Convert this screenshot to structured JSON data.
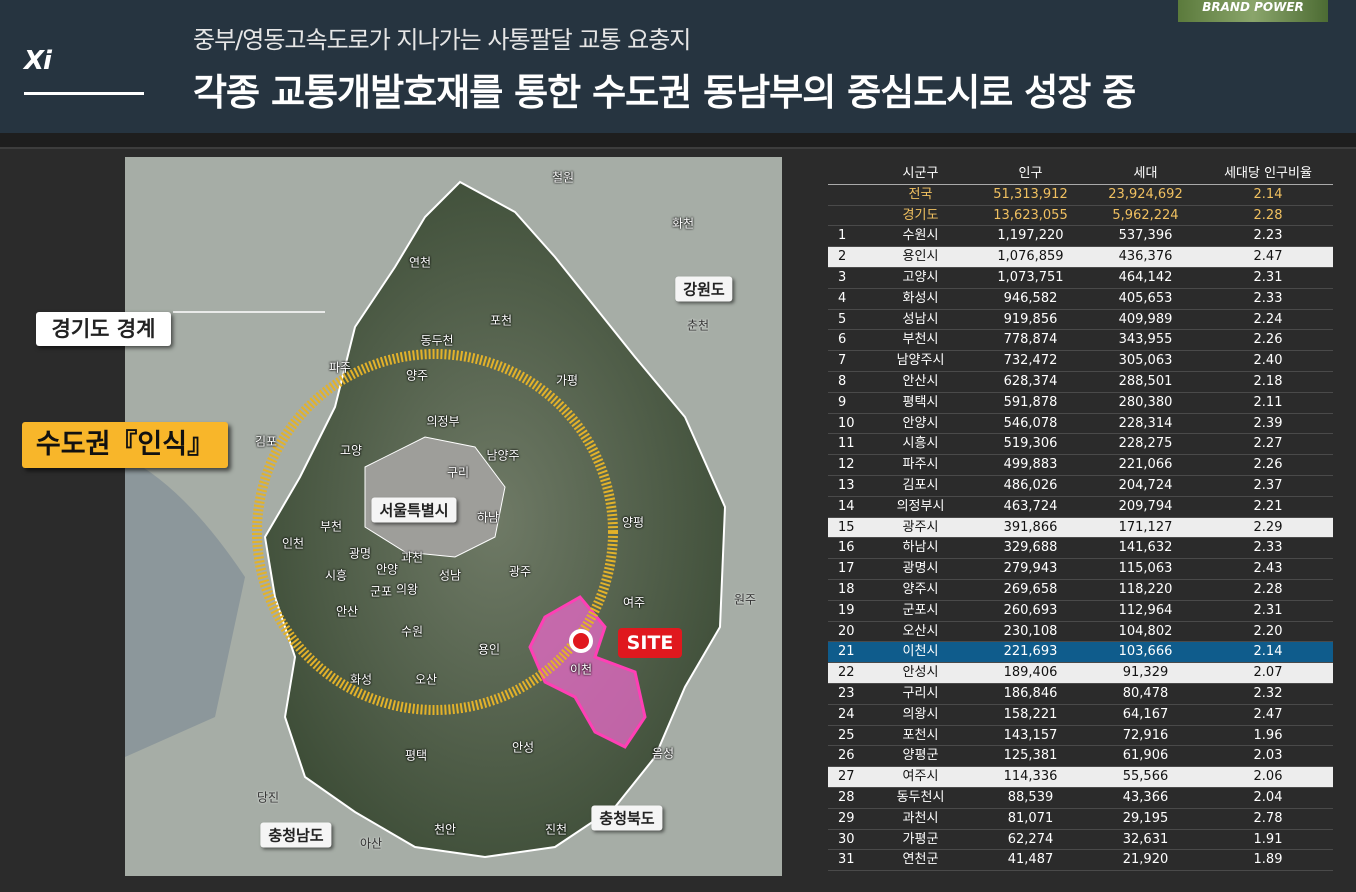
{
  "header": {
    "logo": "Xi",
    "subtitle": "중부/영동고속도로가 지나가는 사통팔달 교통 요충지",
    "title": "각종 교통개발호재를 통한 수도권 동남부의 중심도시로 성장 중",
    "brand_badge": "BRAND POWER"
  },
  "map": {
    "callout_border": "경기도 경계",
    "callout_metro": "수도권『인식』",
    "site_label": "SITE",
    "boxed": {
      "seoul": "서울특별시",
      "gangwon": "강원도",
      "chungbuk": "충청북도",
      "chungnam": "충청남도"
    },
    "places": {
      "cheorwon": "철원",
      "hwacheon": "화천",
      "yeoncheon": "연천",
      "dongducheon": "동두천",
      "pocheon": "포천",
      "chuncheon": "춘천",
      "paju": "파주",
      "yangju": "양주",
      "gapyeong": "가평",
      "uijeongbu": "의정부",
      "gimpo": "김포",
      "goyang": "고양",
      "guri": "구리",
      "namyangju": "남양주",
      "hanam": "하남",
      "yangpyeong": "양평",
      "incheon": "인천",
      "bucheon": "부천",
      "gwangmyeong": "광명",
      "gwacheon": "과천",
      "anyang": "안양",
      "siheung": "시흥",
      "gunpo": "군포",
      "uiwang": "의왕",
      "seongnam": "성남",
      "gwangju": "광주",
      "ansan": "안산",
      "suwon": "수원",
      "yeoju": "여주",
      "wonju": "원주",
      "yongin": "용인",
      "icheon": "이천",
      "hwaseong": "화성",
      "osan": "오산",
      "anseong": "안성",
      "eumseong": "음성",
      "pyeongtaek": "평택",
      "dangjin": "당진",
      "asan": "아산",
      "cheonan": "천안",
      "jincheon": "진천"
    }
  },
  "table": {
    "headers": [
      "시군구",
      "인구",
      "세대",
      "세대당 인구비율"
    ],
    "summary": [
      {
        "name": "전국",
        "pop": "51,313,912",
        "hh": "23,924,692",
        "ratio": "2.14"
      },
      {
        "name": "경기도",
        "pop": "13,623,055",
        "hh": "5,962,224",
        "ratio": "2.28"
      }
    ],
    "rows": [
      {
        "rank": "1",
        "name": "수원시",
        "pop": "1,197,220",
        "hh": "537,396",
        "ratio": "2.23"
      },
      {
        "rank": "2",
        "name": "용인시",
        "pop": "1,076,859",
        "hh": "436,376",
        "ratio": "2.47"
      },
      {
        "rank": "3",
        "name": "고양시",
        "pop": "1,073,751",
        "hh": "464,142",
        "ratio": "2.31"
      },
      {
        "rank": "4",
        "name": "화성시",
        "pop": "946,582",
        "hh": "405,653",
        "ratio": "2.33"
      },
      {
        "rank": "5",
        "name": "성남시",
        "pop": "919,856",
        "hh": "409,989",
        "ratio": "2.24"
      },
      {
        "rank": "6",
        "name": "부천시",
        "pop": "778,874",
        "hh": "343,955",
        "ratio": "2.26"
      },
      {
        "rank": "7",
        "name": "남양주시",
        "pop": "732,472",
        "hh": "305,063",
        "ratio": "2.40"
      },
      {
        "rank": "8",
        "name": "안산시",
        "pop": "628,374",
        "hh": "288,501",
        "ratio": "2.18"
      },
      {
        "rank": "9",
        "name": "평택시",
        "pop": "591,878",
        "hh": "280,380",
        "ratio": "2.11"
      },
      {
        "rank": "10",
        "name": "안양시",
        "pop": "546,078",
        "hh": "228,314",
        "ratio": "2.39"
      },
      {
        "rank": "11",
        "name": "시흥시",
        "pop": "519,306",
        "hh": "228,275",
        "ratio": "2.27"
      },
      {
        "rank": "12",
        "name": "파주시",
        "pop": "499,883",
        "hh": "221,066",
        "ratio": "2.26"
      },
      {
        "rank": "13",
        "name": "김포시",
        "pop": "486,026",
        "hh": "204,724",
        "ratio": "2.37"
      },
      {
        "rank": "14",
        "name": "의정부시",
        "pop": "463,724",
        "hh": "209,794",
        "ratio": "2.21"
      },
      {
        "rank": "15",
        "name": "광주시",
        "pop": "391,866",
        "hh": "171,127",
        "ratio": "2.29"
      },
      {
        "rank": "16",
        "name": "하남시",
        "pop": "329,688",
        "hh": "141,632",
        "ratio": "2.33"
      },
      {
        "rank": "17",
        "name": "광명시",
        "pop": "279,943",
        "hh": "115,063",
        "ratio": "2.43"
      },
      {
        "rank": "18",
        "name": "양주시",
        "pop": "269,658",
        "hh": "118,220",
        "ratio": "2.28"
      },
      {
        "rank": "19",
        "name": "군포시",
        "pop": "260,693",
        "hh": "112,964",
        "ratio": "2.31"
      },
      {
        "rank": "20",
        "name": "오산시",
        "pop": "230,108",
        "hh": "104,802",
        "ratio": "2.20"
      },
      {
        "rank": "21",
        "name": "이천시",
        "pop": "221,693",
        "hh": "103,666",
        "ratio": "2.14"
      },
      {
        "rank": "22",
        "name": "안성시",
        "pop": "189,406",
        "hh": "91,329",
        "ratio": "2.07"
      },
      {
        "rank": "23",
        "name": "구리시",
        "pop": "186,846",
        "hh": "80,478",
        "ratio": "2.32"
      },
      {
        "rank": "24",
        "name": "의왕시",
        "pop": "158,221",
        "hh": "64,167",
        "ratio": "2.47"
      },
      {
        "rank": "25",
        "name": "포천시",
        "pop": "143,157",
        "hh": "72,916",
        "ratio": "1.96"
      },
      {
        "rank": "26",
        "name": "양평군",
        "pop": "125,381",
        "hh": "61,906",
        "ratio": "2.03"
      },
      {
        "rank": "27",
        "name": "여주시",
        "pop": "114,336",
        "hh": "55,566",
        "ratio": "2.06"
      },
      {
        "rank": "28",
        "name": "동두천시",
        "pop": "88,539",
        "hh": "43,366",
        "ratio": "2.04"
      },
      {
        "rank": "29",
        "name": "과천시",
        "pop": "81,071",
        "hh": "29,195",
        "ratio": "2.78"
      },
      {
        "rank": "30",
        "name": "가평군",
        "pop": "62,274",
        "hh": "32,631",
        "ratio": "1.91"
      },
      {
        "rank": "31",
        "name": "연천군",
        "pop": "41,487",
        "hh": "21,920",
        "ratio": "1.89"
      }
    ],
    "highlight_light": [
      "2",
      "15",
      "22",
      "27"
    ],
    "highlight_current": "21"
  },
  "colors": {
    "header_bg": "#263440",
    "metro_ring": "#e3b22a",
    "callout_metro_bg": "#f8b62a",
    "site_region": "#e86ac8",
    "site_label_bg": "#e0181e",
    "current_row_bg": "#0f5c8c",
    "highlight_row_bg": "#ededed",
    "national_row_text": "#f0c060"
  }
}
